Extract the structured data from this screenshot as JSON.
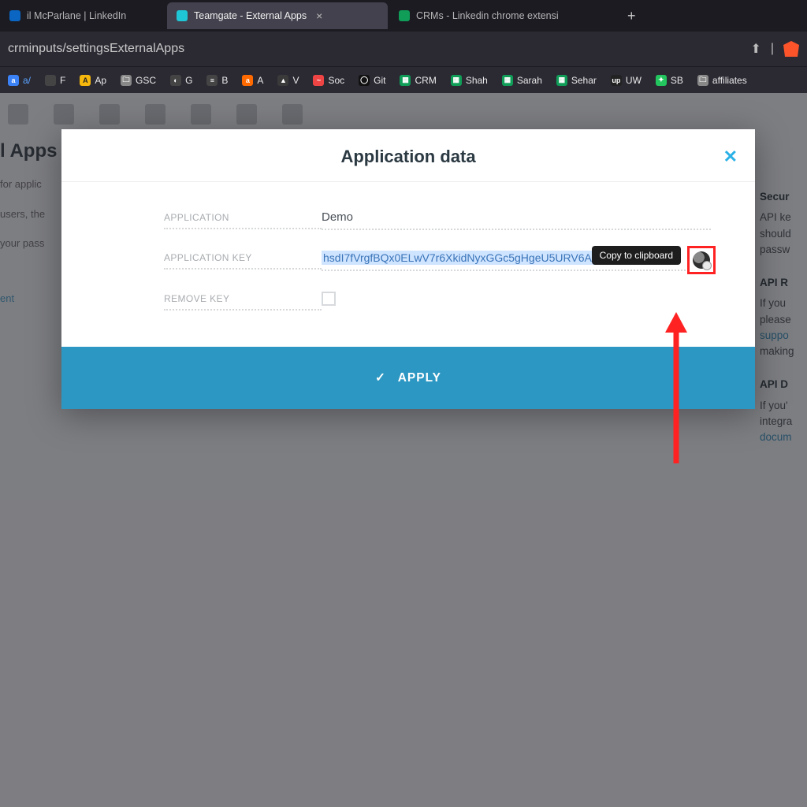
{
  "browser": {
    "tabs": [
      {
        "title": "il McParlane | LinkedIn",
        "favicon_color": "#0a66c2",
        "active": false
      },
      {
        "title": "Teamgate - External Apps",
        "favicon_color": "#1fc6d6",
        "active": true
      },
      {
        "title": "CRMs - Linkedin chrome extensi",
        "favicon_color": "#0f9d58",
        "active": false
      }
    ],
    "url": "crminputs/settingsExternalApps",
    "share_icon": "⬆",
    "bookmarks": [
      {
        "label": "a/",
        "color": "#3b82f6",
        "fav_text": "a"
      },
      {
        "label": "F",
        "color": "#444",
        "fav_text": "F"
      },
      {
        "label": "Ap",
        "color": "#f6b80c",
        "fav_text": "A"
      },
      {
        "label": "GSC",
        "color": "#6b7280",
        "fav_text": ""
      },
      {
        "label": "G",
        "color": "#6b7280",
        "fav_text": ""
      },
      {
        "label": "B",
        "color": "#444",
        "fav_text": "≡"
      },
      {
        "label": "A",
        "color": "#ff6a00",
        "fav_text": "a"
      },
      {
        "label": "V",
        "color": "#3a3a3a",
        "fav_text": "▲"
      },
      {
        "label": "Soc",
        "color": "#ef4444",
        "fav_text": "●"
      },
      {
        "label": "Git",
        "color": "#111",
        "fav_text": "◯"
      },
      {
        "label": "CRM",
        "color": "#0f9d58",
        "fav_text": ""
      },
      {
        "label": "Shah",
        "color": "#0f9d58",
        "fav_text": ""
      },
      {
        "label": "Sarah",
        "color": "#0f9d58",
        "fav_text": ""
      },
      {
        "label": "Sehar",
        "color": "#0f9d58",
        "fav_text": ""
      },
      {
        "label": "UW",
        "color": "#222",
        "fav_text": "up"
      },
      {
        "label": "SB",
        "color": "#22c55e",
        "fav_text": "✦"
      },
      {
        "label": "affiliates",
        "color": "#6b7280",
        "fav_text": ""
      }
    ]
  },
  "background_page": {
    "page_heading": "l Apps",
    "left_text1": "for applic",
    "left_text2": "users, the",
    "left_text3": "your pass",
    "left_btn": "ent",
    "right": {
      "h1": "Secur",
      "p1a": "API ke",
      "p1b": "should",
      "p1c": "passw",
      "h2": "API R",
      "p2a": "If you",
      "p2b": "please",
      "p2c": "suppo",
      "p2d": "making",
      "h3": "API D",
      "p3a": "If you'",
      "p3b": "integra",
      "p3c": "docum"
    }
  },
  "modal": {
    "title": "Application data",
    "close": "✕",
    "rows": {
      "app_label": "APPLICATION",
      "app_value": "Demo",
      "key_label": "APPLICATION KEY",
      "key_value": "hsdI7fVrgfBQx0ELwV7r6XkidNyxGGc5gHgeU5URV6AGcbp7D",
      "remove_label": "REMOVE KEY"
    },
    "tooltip": "Copy to clipboard",
    "apply": "APPLY"
  }
}
